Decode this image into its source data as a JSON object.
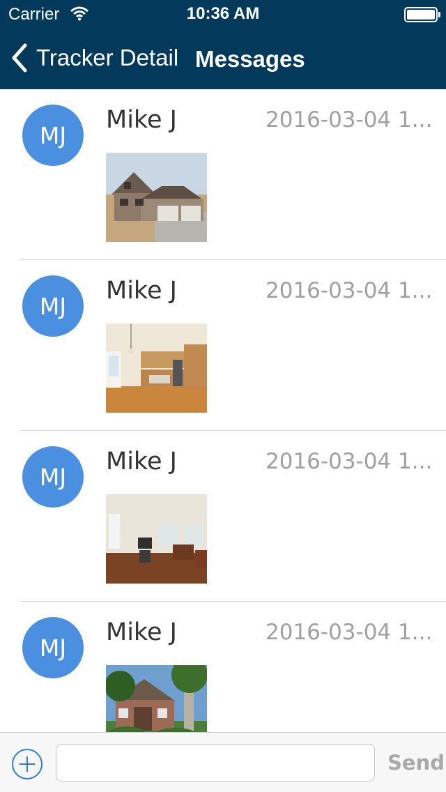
{
  "status_bar": {
    "carrier": "Carrier",
    "time": "10:36 AM"
  },
  "nav": {
    "back_label": "Tracker Detail",
    "title": "Messages"
  },
  "colors": {
    "bar": "#033a5c",
    "avatar": "#4a8fe0",
    "timestamp": "#a0a0a0",
    "send_disabled": "#a9a9a9"
  },
  "messages": [
    {
      "initials": "MJ",
      "sender": "Mike J",
      "timestamp": "2016-03-04 1...",
      "photo": "house-exterior"
    },
    {
      "initials": "MJ",
      "sender": "Mike J",
      "timestamp": "2016-03-04 1...",
      "photo": "kitchen"
    },
    {
      "initials": "MJ",
      "sender": "Mike J",
      "timestamp": "2016-03-04 1...",
      "photo": "living-room"
    },
    {
      "initials": "MJ",
      "sender": "Mike J",
      "timestamp": "2016-03-04 1...",
      "photo": "house-front-with-tree"
    }
  ],
  "composer": {
    "input_value": "",
    "placeholder": "",
    "send_label": "Send"
  }
}
